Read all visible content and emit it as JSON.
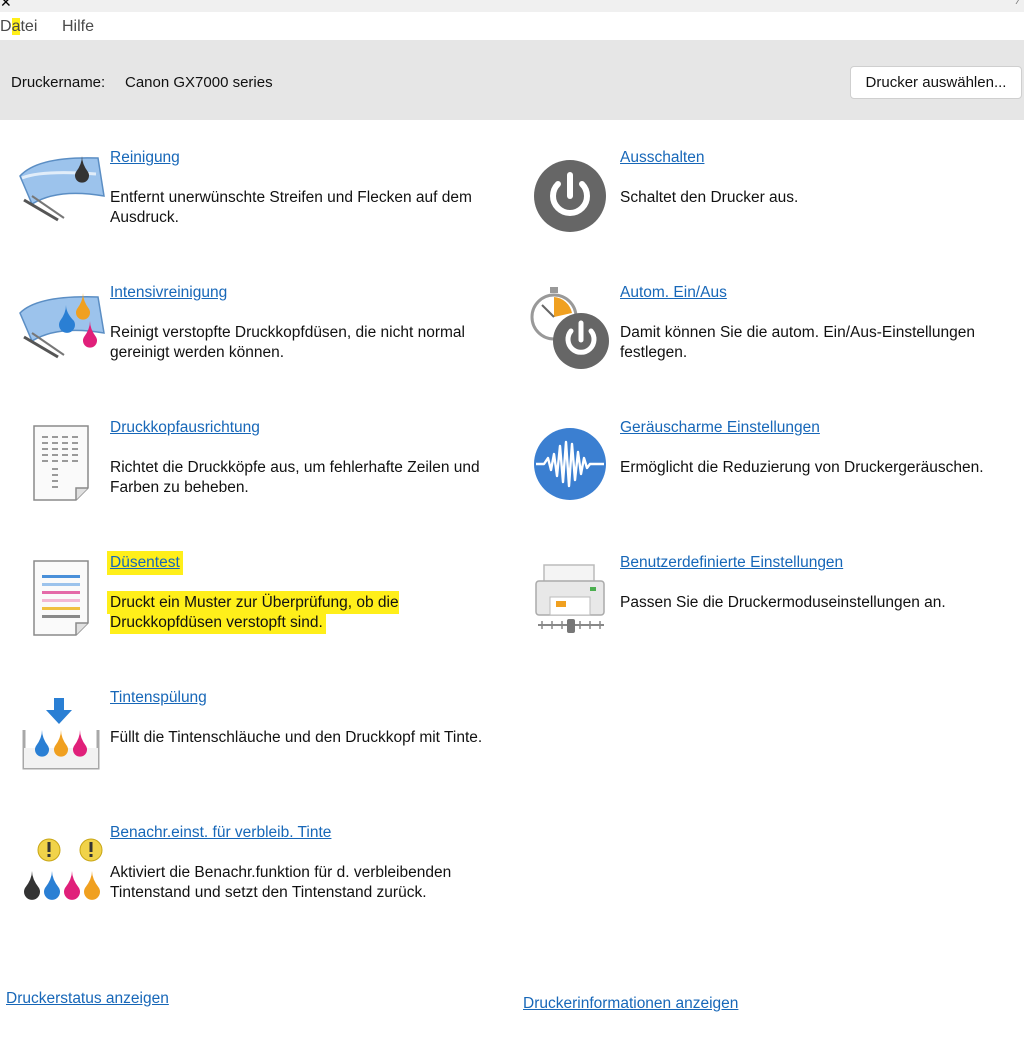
{
  "menubar": {
    "file_prefix": "D",
    "file_highlight": "a",
    "file_suffix": "tei",
    "help": "Hilfe"
  },
  "printer": {
    "label": "Druckername:",
    "name": "Canon GX7000 series",
    "select_button": "Drucker auswählen..."
  },
  "left_tools": [
    {
      "id": "reinigung",
      "title": "Reinigung",
      "desc": "Entfernt unerwünschte Streifen und Flecken auf dem Ausdruck.",
      "icon": "cleaning-icon"
    },
    {
      "id": "intensivreinigung",
      "title": "Intensivreinigung",
      "desc": "Reinigt verstopfte Druckkopfdüsen, die nicht normal gereinigt werden können.",
      "icon": "deep-cleaning-icon"
    },
    {
      "id": "druckkopfausrichtung",
      "title": "Druckkopfausrichtung",
      "desc": "Richtet die Druckköpfe aus, um fehlerhafte Zeilen und Farben zu beheben.",
      "icon": "alignment-page-icon"
    },
    {
      "id": "duesentest",
      "title": "Düsentest",
      "desc": "Druckt ein Muster zur Überprüfung, ob die Druckkopfdüsen verstopft sind.",
      "icon": "nozzle-check-page-icon",
      "highlighted": true
    },
    {
      "id": "tintenspuelung",
      "title": "Tintenspülung",
      "desc": "Füllt die Tintenschläuche und den Druckkopf mit Tinte.",
      "icon": "ink-flush-icon"
    },
    {
      "id": "benachrichtigung",
      "title": "Benachr.einst. für verbleib. Tinte",
      "desc": "Aktiviert die Benachr.funktion für d. verbleibenden Tintenstand und setzt den Tintenstand zurück.",
      "icon": "ink-warning-icon"
    }
  ],
  "right_tools": [
    {
      "id": "ausschalten",
      "title": "Ausschalten",
      "desc": "Schaltet den Drucker aus.",
      "icon": "power-icon"
    },
    {
      "id": "autom-ein-aus",
      "title": "Autom. Ein/Aus",
      "desc": "Damit können Sie die autom. Ein/Aus-Einstellungen festlegen.",
      "icon": "auto-power-timer-icon"
    },
    {
      "id": "geraeuscharm",
      "title": "Geräuscharme Einstellungen",
      "desc": "Ermöglicht die Reduzierung von Druckergeräuschen.",
      "icon": "sound-wave-icon"
    },
    {
      "id": "benutzerdefiniert",
      "title": "Benutzerdefinierte Einstellungen",
      "desc": "Passen Sie die Druckermoduseinstellungen an.",
      "icon": "printer-settings-icon"
    }
  ],
  "footer": {
    "status_link": "Druckerstatus anzeigen",
    "info_link": "Druckerinformationen anzeigen"
  },
  "colors": {
    "link": "#1767b8",
    "highlight": "#ffef1a",
    "header_bg": "#e6e6e6"
  }
}
